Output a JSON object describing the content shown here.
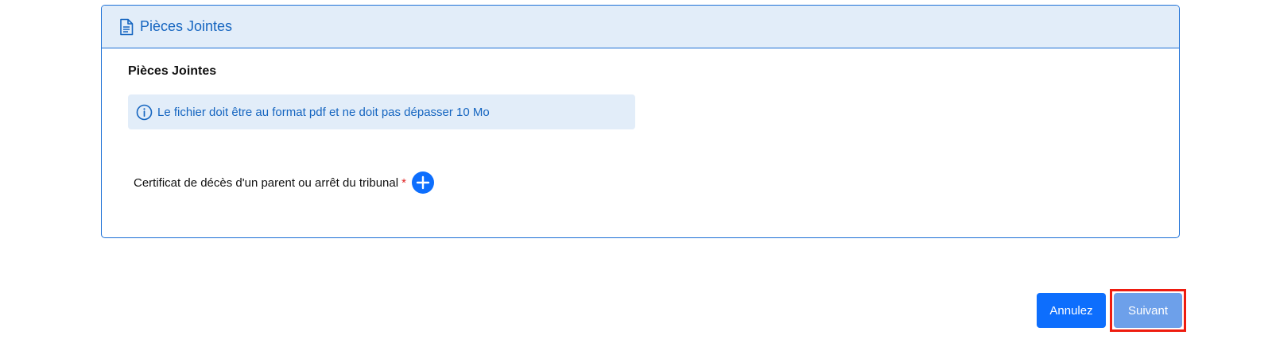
{
  "card": {
    "title": "Pièces Jointes",
    "header_icon": "document-icon"
  },
  "section": {
    "title": "Pièces Jointes"
  },
  "info": {
    "icon": "info-icon",
    "text": "Le fichier doit être au format pdf et ne doit pas dépasser 10 Mo"
  },
  "field": {
    "label": "Certificat de décès d'un parent ou arrêt du tribunal",
    "required_marker": "*",
    "add_icon": "plus-circle-icon"
  },
  "actions": {
    "cancel_label": "Annulez",
    "next_label": "Suivant"
  },
  "colors": {
    "primary": "#0d6efd",
    "accent_text": "#1565c0",
    "header_bg": "#e2edf9",
    "highlight": "#ee1c0f",
    "next_button": "#6da0ea"
  }
}
